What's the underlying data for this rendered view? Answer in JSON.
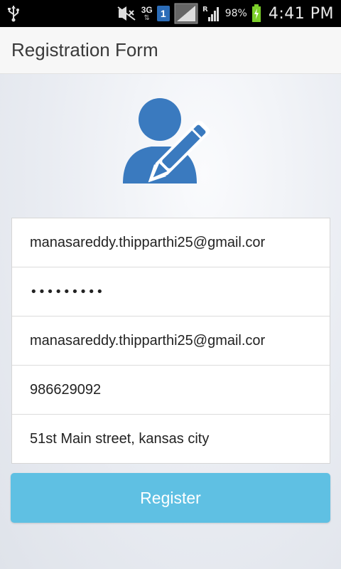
{
  "status_bar": {
    "network_type": "3G",
    "sim_slot": "1",
    "roaming": "R",
    "battery_percent": "98%",
    "time": "4:41 PM",
    "icons": [
      "usb-icon",
      "mute-icon",
      "3g-icon",
      "sim-icon",
      "signal-icon",
      "signal-icon",
      "battery-icon"
    ]
  },
  "app_bar": {
    "title": "Registration Form"
  },
  "form": {
    "email": "manasareddy.thipparthi25@gmail.cor",
    "password": "•••••••••",
    "confirm_email": "manasareddy.thipparthi25@gmail.cor",
    "phone": "986629092",
    "address": "51st Main street, kansas city"
  },
  "register_button": {
    "label": "Register"
  },
  "colors": {
    "button": "#5fc0e3",
    "avatar": "#3a7abf",
    "status_bar": "#000000",
    "app_bar": "#f7f7f7"
  }
}
